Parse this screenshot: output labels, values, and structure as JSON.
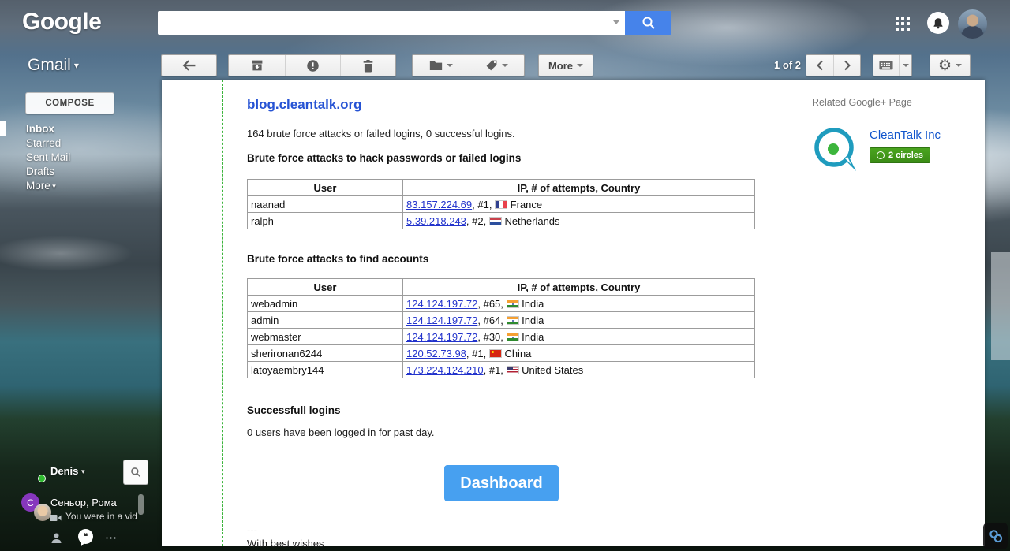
{
  "topbar": {
    "logo": "Google",
    "search_value": "",
    "search_placeholder": ""
  },
  "toolbar": {
    "more_label": "More",
    "pager": "1 of 2"
  },
  "sidebar": {
    "gmail_label": "Gmail",
    "compose_label": "COMPOSE",
    "items": [
      {
        "label": "Inbox",
        "bold": true
      },
      {
        "label": "Starred",
        "bold": false
      },
      {
        "label": "Sent Mail",
        "bold": false
      },
      {
        "label": "Drafts",
        "bold": false
      },
      {
        "label": "More",
        "bold": false,
        "caret": true
      }
    ]
  },
  "email": {
    "from_link": "blog.cleantalk.org",
    "summary": "164 brute force attacks or failed logins, 0 successful logins.",
    "sections": [
      {
        "heading": "Brute force attacks to hack passwords or failed logins",
        "columns": [
          "User",
          "IP, # of attempts, Country"
        ],
        "rows": [
          {
            "user": "naanad",
            "ip": "83.157.224.69",
            "attempts": "#1",
            "country": "France",
            "cc": "fr"
          },
          {
            "user": "ralph",
            "ip": "5.39.218.243",
            "attempts": "#2",
            "country": "Netherlands",
            "cc": "nl"
          }
        ]
      },
      {
        "heading": "Brute force attacks to find accounts",
        "columns": [
          "User",
          "IP, # of attempts, Country"
        ],
        "rows": [
          {
            "user": "webadmin",
            "ip": "124.124.197.72",
            "attempts": "#65",
            "country": "India",
            "cc": "in"
          },
          {
            "user": "admin",
            "ip": "124.124.197.72",
            "attempts": "#64",
            "country": "India",
            "cc": "in"
          },
          {
            "user": "webmaster",
            "ip": "124.124.197.72",
            "attempts": "#30",
            "country": "India",
            "cc": "in"
          },
          {
            "user": "sherironan6244",
            "ip": "120.52.73.98",
            "attempts": "#1",
            "country": "China",
            "cc": "cn"
          },
          {
            "user": "latoyaembry144",
            "ip": "173.224.124.210",
            "attempts": "#1",
            "country": "United States",
            "cc": "us"
          }
        ]
      }
    ],
    "success_heading": "Successfull logins",
    "success_text": "0 users have been logged in for past day.",
    "dashboard_label": "Dashboard",
    "signature_dashes": "---",
    "signature_text": "With best wishes"
  },
  "gplus": {
    "title": "Related Google+ Page",
    "name": "CleanTalk Inc",
    "circles_label": "2 circles"
  },
  "chat": {
    "me": "Denis",
    "contact": "Сеньор, Рома",
    "snippet": "You were in a vid"
  },
  "icons": {
    "caret": "▾",
    "gear": "⚙",
    "overflow": "⋯"
  },
  "colors": {
    "search_button_blue": "#4683ea",
    "dashboard_blue": "#47a0f0",
    "link_blue": "#2233cc",
    "header_link_blue": "#2653d4",
    "badge_green": "#3b8c16",
    "dashed_divider_green": "#3cb43c",
    "cleantalk_teal": "#1f9cbe",
    "cleantalk_dot_green": "#3cb53c"
  }
}
